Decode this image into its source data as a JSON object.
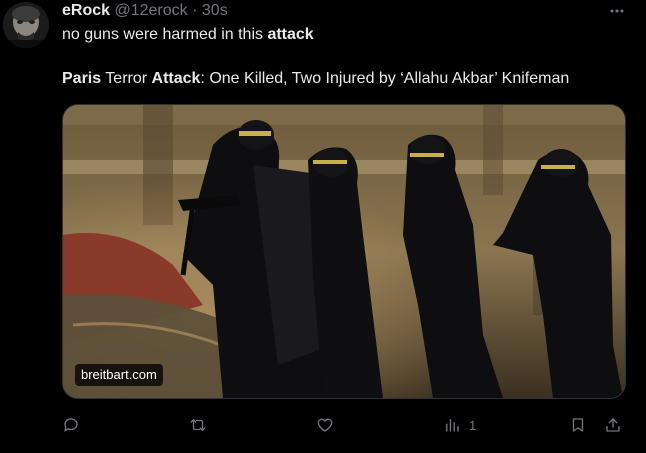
{
  "author": {
    "name": "eRock",
    "handle": "@12erock",
    "separator": "·",
    "time": "30s"
  },
  "tweet": {
    "line1_prefix": "no guns were harmed in this ",
    "line1_bold": "attack",
    "line2_bold1": "Paris",
    "line2_text1": " Terror ",
    "line2_bold2": "Attack",
    "line2_text2": ": One Killed, Two Injured by ‘Allahu Akbar’ Knifeman"
  },
  "media": {
    "domain": "breitbart.com"
  },
  "actions": {
    "views_count": "1"
  },
  "icons": {
    "more": "more-horizontal-icon",
    "reply": "reply-icon",
    "retweet": "retweet-icon",
    "like": "heart-icon",
    "views": "views-icon",
    "bookmark": "bookmark-icon",
    "share": "share-icon"
  },
  "colors": {
    "background": "#000000",
    "text": "#e7e9ea",
    "muted": "#71767b"
  }
}
